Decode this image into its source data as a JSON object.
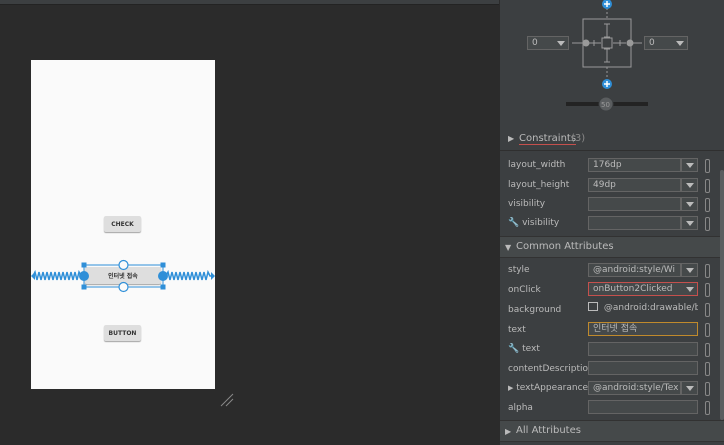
{
  "preview": {
    "check_label": "CHECK",
    "selected_text": "인터넷 접속",
    "button_label": "BUTTON"
  },
  "constraint_widget": {
    "left_margin": "0",
    "right_margin": "0"
  },
  "sections": {
    "constraints": "Constraints",
    "constraints_count": "(3)",
    "common": "Common Attributes",
    "all": "All Attributes"
  },
  "layout": {
    "width_label": "layout_width",
    "width_value": "176dp",
    "height_label": "layout_height",
    "height_value": "49dp",
    "visibility_label": "visibility",
    "visibility_value": "",
    "tools_visibility_label": "visibility",
    "tools_visibility_value": ""
  },
  "attrs": {
    "style_label": "style",
    "style_value": "@android:style/Wi",
    "onclick_label": "onClick",
    "onclick_value": "onButton2Clicked",
    "background_label": "background",
    "background_value": "@android:drawable/b",
    "text_label": "text",
    "text_value": "인터넷 접속",
    "tools_text_label": "text",
    "tools_text_value": "",
    "content_desc_label": "contentDescription",
    "content_desc_value": "",
    "text_appearance_label": "textAppearance",
    "text_appearance_value": "@android:style/Tex",
    "alpha_label": "alpha",
    "alpha_value": ""
  },
  "colors": {
    "accent": "#2f8fd8",
    "warning_border": "#c5504d",
    "focus_border": "#c08a2c"
  }
}
